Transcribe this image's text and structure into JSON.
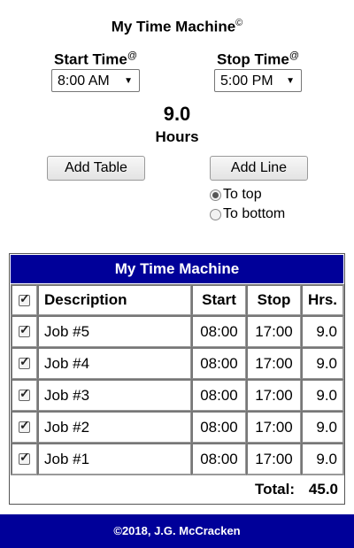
{
  "app": {
    "title": "My Time Machine",
    "title_mark": "©"
  },
  "controls": {
    "start_label": "Start Time",
    "start_mark": "@",
    "start_value": "8:00 AM",
    "stop_label": "Stop Time",
    "stop_mark": "@",
    "stop_value": "5:00 PM",
    "dropdown_arrow": "▼"
  },
  "hours": {
    "value": "9.0",
    "label": "Hours"
  },
  "buttons": {
    "add_table": "Add Table",
    "add_line": "Add Line"
  },
  "insert_position": {
    "options": [
      "To top",
      "To bottom"
    ],
    "selected": "To top"
  },
  "table": {
    "title": "My Time Machine",
    "headers": {
      "description": "Description",
      "start": "Start",
      "stop": "Stop",
      "hrs": "Hrs."
    },
    "rows": [
      {
        "checked": true,
        "description": "Job #5",
        "start": "08:00",
        "stop": "17:00",
        "hrs": "9.0"
      },
      {
        "checked": true,
        "description": "Job #4",
        "start": "08:00",
        "stop": "17:00",
        "hrs": "9.0"
      },
      {
        "checked": true,
        "description": "Job #3",
        "start": "08:00",
        "stop": "17:00",
        "hrs": "9.0"
      },
      {
        "checked": true,
        "description": "Job #2",
        "start": "08:00",
        "stop": "17:00",
        "hrs": "9.0"
      },
      {
        "checked": true,
        "description": "Job #1",
        "start": "08:00",
        "stop": "17:00",
        "hrs": "9.0"
      }
    ],
    "total_label": "Total:",
    "total_value": "45.0"
  },
  "footer": {
    "text": "©2018, J.G. McCracken"
  },
  "colors": {
    "brand": "#000099"
  }
}
